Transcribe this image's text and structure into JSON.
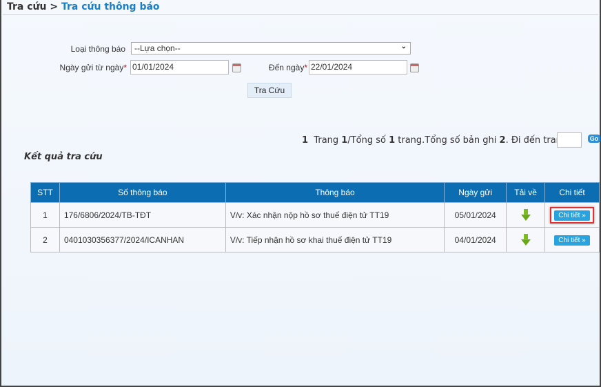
{
  "breadcrumb": {
    "parent": "Tra cứu",
    "separator": ">",
    "current": "Tra cứu thông báo"
  },
  "form": {
    "type_label": "Loại thông báo",
    "type_value": "--Lựa chọn--",
    "from_label": "Ngày gửi từ ngày",
    "from_value": "01/01/2024",
    "to_label": "Đến ngày",
    "to_value": "22/01/2024",
    "required_mark": "*",
    "search_button": "Tra Cứu"
  },
  "pager": {
    "page_link": "1",
    "t1": "Trang ",
    "page": "1",
    "t2": "/Tổng số ",
    "total_pages": "1",
    "t3": " trang.Tổng số bản ghi ",
    "records": "2",
    "t4": ". Đi đến trang",
    "go": "Go"
  },
  "results_title": "Kết quả tra cứu",
  "table": {
    "headers": [
      "STT",
      "Số thông báo",
      "Thông báo",
      "Ngày gửi",
      "Tải về",
      "Chi tiết"
    ],
    "rows": [
      {
        "stt": "1",
        "so": "176/6806/2024/TB-TĐT",
        "tb": "V/v: Xác nhận nộp hồ sơ thuế điện tử TT19",
        "ngay": "05/01/2024",
        "detail": "Chi tiết »"
      },
      {
        "stt": "2",
        "so": "0401030356377/2024/ICANHAN",
        "tb": "V/v: Tiếp nhận hồ sơ khai thuế điện tử TT19",
        "ngay": "04/01/2024",
        "detail": "Chi tiết »"
      }
    ]
  }
}
